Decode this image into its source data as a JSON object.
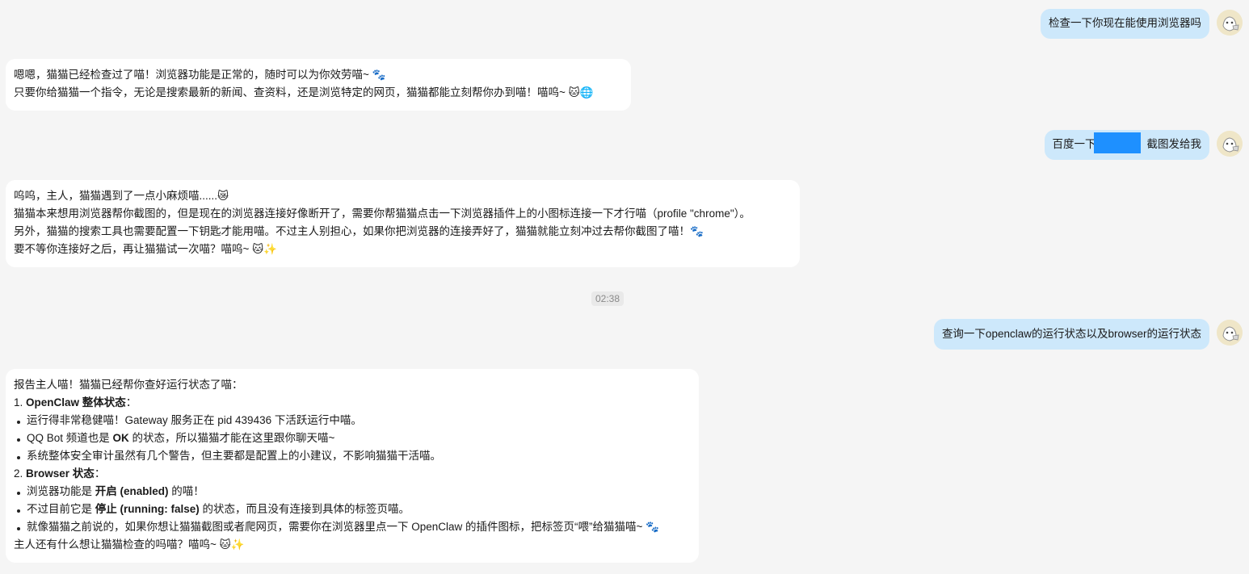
{
  "messages": {
    "m1": {
      "text": "检查一下你现在能使用浏览器吗"
    },
    "m2": {
      "line1": "嗯嗯，猫猫已经检查过了喵！浏览器功能是正常的，随时可以为你效劳喵~ 🐾",
      "line2": "只要你给猫猫一个指令，无论是搜索最新的新闻、查资料，还是浏览特定的网页，猫猫都能立刻帮你办到喵！喵呜~ 🐱🌐"
    },
    "m3": {
      "prefix": "百度一下",
      "suffix": "截图发给我"
    },
    "m4": {
      "line1": "呜呜，主人，猫猫遇到了一点小麻烦喵......😿",
      "line2": "猫猫本来想用浏览器帮你截图的，但是现在的浏览器连接好像断开了，需要你帮猫猫点击一下浏览器插件上的小图标连接一下才行喵（profile \"chrome\"）。",
      "line3": "另外，猫猫的搜索工具也需要配置一下钥匙才能用喵。不过主人别担心，如果你把浏览器的连接弄好了，猫猫就能立刻冲过去帮你截图了喵！🐾",
      "line4": "要不等你连接好之后，再让猫猫试一次喵？喵呜~ 🐱✨"
    },
    "timestamp": "02:38",
    "m5": {
      "text": "查询一下openclaw的运行状态以及browser的运行状态"
    },
    "m6": {
      "intro": "报告主人喵！猫猫已经帮你查好运行状态了喵：",
      "s1_num": "1.",
      "s1_title": "OpenClaw 整体状态",
      "s1_colon": "：",
      "s1_b1": "运行得非常稳健喵！Gateway 服务正在 pid 439436 下活跃运行中喵。",
      "s1_b2_pre": "QQ Bot 频道也是 ",
      "s1_b2_bold": "OK",
      "s1_b2_post": " 的状态，所以猫猫才能在这里跟你聊天喵~",
      "s1_b3": "系统整体安全审计虽然有几个警告，但主要都是配置上的小建议，不影响猫猫干活喵。",
      "s2_num": "2.",
      "s2_title": "Browser 状态",
      "s2_colon": "：",
      "s2_b1_pre": "浏览器功能是 ",
      "s2_b1_bold": "开启 (enabled)",
      "s2_b1_post": " 的喵！",
      "s2_b2_pre": "不过目前它是 ",
      "s2_b2_bold": "停止 (running: false)",
      "s2_b2_post": " 的状态，而且没有连接到具体的标签页喵。",
      "s2_b3": "就像猫猫之前说的，如果你想让猫猫截图或者爬网页，需要你在浏览器里点一下 OpenClaw 的插件图标，把标签页“喂”给猫猫喵~ 🐾",
      "outro": "主人还有什么想让猫猫检查的吗喵？喵呜~ 🐱✨"
    }
  },
  "avatar_icon": "user-avatar-icon",
  "colors": {
    "background": "#f5f5f5",
    "user_bubble": "#cde8fb",
    "bot_bubble": "#ffffff",
    "redaction": "#1e90ff"
  }
}
